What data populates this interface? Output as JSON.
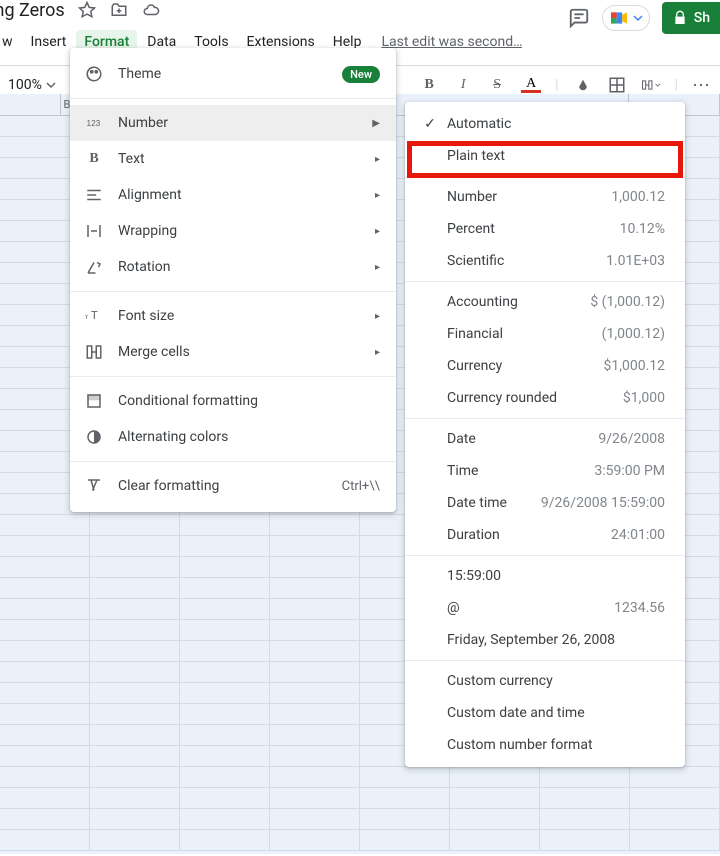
{
  "doc": {
    "title": "ding Zeros"
  },
  "menubar": {
    "items": [
      "w",
      "Insert",
      "Format",
      "Data",
      "Tools",
      "Extensions",
      "Help"
    ],
    "edit_status": "Last edit was second…"
  },
  "toolbar": {
    "zoom": "100%",
    "bold": "B",
    "italic": "I",
    "strike": "S",
    "textcolor": "A",
    "more": "⋯"
  },
  "share": {
    "label": "Sh"
  },
  "columns": [
    "",
    "B",
    "",
    "",
    "",
    "",
    ""
  ],
  "format_menu": {
    "theme": {
      "label": "Theme",
      "badge": "New"
    },
    "number": "Number",
    "text": "Text",
    "alignment": "Alignment",
    "wrapping": "Wrapping",
    "rotation": "Rotation",
    "fontsize": "Font size",
    "merge": "Merge cells",
    "conditional": "Conditional formatting",
    "altcolors": "Alternating colors",
    "clear": {
      "label": "Clear formatting",
      "shortcut": "Ctrl+\\\\"
    }
  },
  "number_menu": {
    "automatic": "Automatic",
    "plaintext": "Plain text",
    "number": {
      "label": "Number",
      "example": "1,000.12"
    },
    "percent": {
      "label": "Percent",
      "example": "10.12%"
    },
    "scientific": {
      "label": "Scientific",
      "example": "1.01E+03"
    },
    "accounting": {
      "label": "Accounting",
      "example": "$ (1,000.12)"
    },
    "financial": {
      "label": "Financial",
      "example": "(1,000.12)"
    },
    "currency": {
      "label": "Currency",
      "example": "$1,000.12"
    },
    "currency_rounded": {
      "label": "Currency rounded",
      "example": "$1,000"
    },
    "date": {
      "label": "Date",
      "example": "9/26/2008"
    },
    "time": {
      "label": "Time",
      "example": "3:59:00 PM"
    },
    "datetime": {
      "label": "Date time",
      "example": "9/26/2008 15:59:00"
    },
    "duration": {
      "label": "Duration",
      "example": "24:01:00"
    },
    "ex1": "15:59:00",
    "ex2": {
      "label": "@",
      "example": "1234.56"
    },
    "ex3": "Friday, September 26, 2008",
    "custom_currency": "Custom currency",
    "custom_datetime": "Custom date and time",
    "custom_number": "Custom number format"
  }
}
